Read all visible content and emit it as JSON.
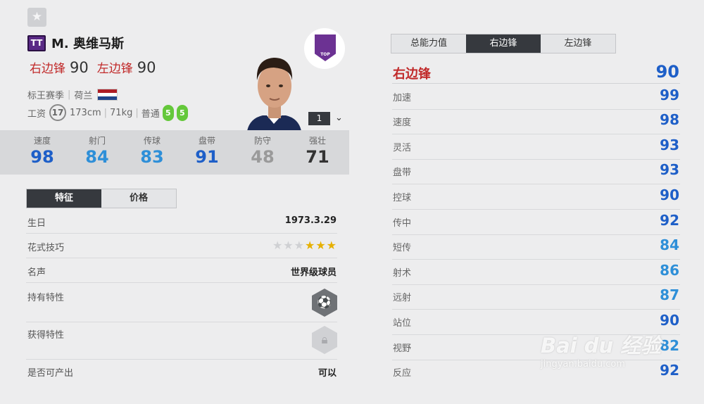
{
  "player": {
    "season_badge": "TT",
    "name": "M. 奥维马斯",
    "positions": [
      {
        "label": "右边锋",
        "ovr": "90"
      },
      {
        "label": "左边锋",
        "ovr": "90"
      }
    ],
    "season": "标王赛季",
    "nationality": "荷兰",
    "salary_label": "工资",
    "salary": "17",
    "height": "173cm",
    "weight": "71kg",
    "body_type": "普通",
    "weak_foot_left": "5",
    "weak_foot_right": "5",
    "rank": "1",
    "club_crest_text": "TOP"
  },
  "summary_stats": [
    {
      "label": "速度",
      "value": "98",
      "color": "#1e5fc8"
    },
    {
      "label": "射门",
      "value": "84",
      "color": "#2e8fd8"
    },
    {
      "label": "传球",
      "value": "83",
      "color": "#2e8fd8"
    },
    {
      "label": "盘带",
      "value": "91",
      "color": "#1e5fc8"
    },
    {
      "label": "防守",
      "value": "48",
      "color": "#9a9a9a"
    },
    {
      "label": "强壮",
      "value": "71",
      "color": "#333333"
    }
  ],
  "left_tabs": [
    {
      "label": "特征",
      "active": true
    },
    {
      "label": "价格",
      "active": false
    }
  ],
  "info": {
    "birthday_label": "生日",
    "birthday": "1973.3.29",
    "skill_label": "花式技巧",
    "skill_stars": 3,
    "skill_stars_max": 6,
    "fame_label": "名声",
    "fame": "世界级球员",
    "traits_owned_label": "持有特性",
    "traits_owned_icon": "dribbling-trait-icon",
    "traits_gain_label": "获得特性",
    "traits_gain_icon": "lock-icon",
    "producible_label": "是否可产出",
    "producible": "可以"
  },
  "right_tabs": [
    {
      "label": "总能力值",
      "active": false
    },
    {
      "label": "右边锋",
      "active": true
    },
    {
      "label": "左边锋",
      "active": false
    }
  ],
  "position_detail": {
    "position": "右边锋",
    "ovr": "90",
    "attributes": [
      {
        "label": "加速",
        "value": "99",
        "color": "#1e5fc8"
      },
      {
        "label": "速度",
        "value": "98",
        "color": "#1e5fc8"
      },
      {
        "label": "灵活",
        "value": "93",
        "color": "#1e5fc8"
      },
      {
        "label": "盘带",
        "value": "93",
        "color": "#1e5fc8"
      },
      {
        "label": "控球",
        "value": "90",
        "color": "#1e5fc8"
      },
      {
        "label": "传中",
        "value": "92",
        "color": "#1e5fc8"
      },
      {
        "label": "短传",
        "value": "84",
        "color": "#2e8fd8"
      },
      {
        "label": "射术",
        "value": "86",
        "color": "#2e8fd8"
      },
      {
        "label": "远射",
        "value": "87",
        "color": "#2e8fd8"
      },
      {
        "label": "站位",
        "value": "90",
        "color": "#1e5fc8"
      },
      {
        "label": "视野",
        "value": "82",
        "color": "#2e8fd8"
      },
      {
        "label": "反应",
        "value": "92",
        "color": "#1e5fc8"
      }
    ]
  },
  "watermark": {
    "main": "Bai du 经验",
    "sub": "jingyan.baidu.com"
  },
  "colors": {
    "accent_red": "#c12a2a",
    "dark_tab": "#36393e",
    "top_blue": "#1e5fc8",
    "light_blue": "#2e8fd8"
  }
}
